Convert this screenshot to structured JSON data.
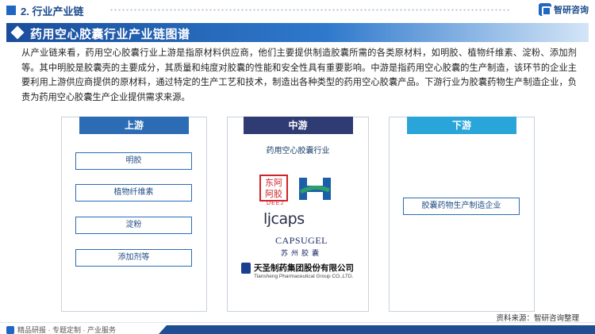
{
  "header": {
    "section_title": "2. 行业产业链",
    "brand_name": "智研咨询"
  },
  "title": "药用空心胶囊行业产业链图谱",
  "intro": "从产业链来看，药用空心胶囊行业上游是指原材料供应商，他们主要提供制造胶囊所需的各类原材料，如明胶、植物纤维素、淀粉、添加剂等。其中明胶是胶囊壳的主要成分，其质量和纯度对胶囊的性能和安全性具有重要影响。中游是指药用空心胶囊的生产制造，该环节的企业主要利用上游供应商提供的原材料，通过特定的生产工艺和技术，制造出各种类型的药用空心胶囊产品。下游行业为胶囊药物生产制造企业，负责为药用空心胶囊生产企业提供需求来源。",
  "upstream": {
    "label": "上游",
    "items": [
      "明胶",
      "植物纤维素",
      "淀粉",
      "添加剂等"
    ]
  },
  "midstream": {
    "label": "中游",
    "industry": "药用空心胶囊行业",
    "logos": {
      "dong_e": {
        "chars": "东阿阿胶",
        "sub": "DEEJ"
      },
      "ljcaps": "ljcaps",
      "capsugel": {
        "en": "CAPSUGEL",
        "cn": "苏州胶囊"
      },
      "tiansheng": {
        "cn": "天圣制药集团股份有限公司",
        "en": "Tiansheng Pharmaceutical Group CO.,LTD."
      }
    }
  },
  "downstream": {
    "label": "下游",
    "items": [
      "胶囊药物生产制造企业"
    ]
  },
  "source": "资料来源：智研咨询整理",
  "footer": "精品研报 · 专题定制 · 产业服务",
  "colors": {
    "primary": "#1f67c2",
    "upstream_head": "#2b6cb5",
    "midstream_head": "#2f3b73",
    "downstream_head": "#2aa5d9"
  }
}
